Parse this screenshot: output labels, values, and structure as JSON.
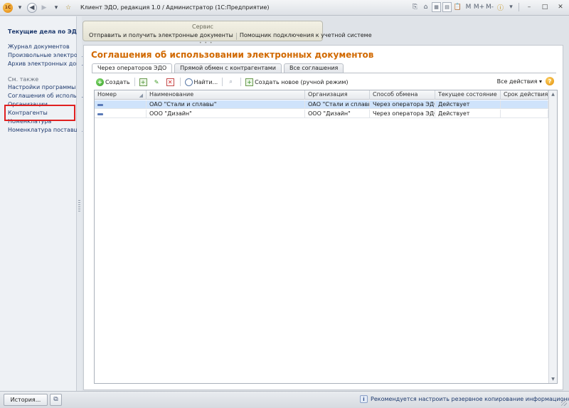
{
  "window": {
    "title": "Клиент ЭДО, редакция 1.0 / Администратор  (1С:Предприятие)",
    "right_icons": [
      "M",
      "M+",
      "M-"
    ]
  },
  "left_panel": {
    "title": "Текущие дела по ЭДО",
    "links": [
      "Журнал документов",
      "Произвольные электро...",
      "Архив электронных док..."
    ],
    "see_also_label": "См. также",
    "see_also_links": [
      "Настройки программы",
      "Соглашения об использ...",
      "Организации",
      "Контрагенты",
      "Номенклатура",
      "Номенклатура поставщ..."
    ]
  },
  "service": {
    "title": "Сервис",
    "commands": [
      "Отправить и получить электронные документы",
      "Помощник подключения к учетной системе"
    ]
  },
  "form": {
    "title": "Соглашения об использовании электронных документов",
    "tabs": [
      "Через операторов ЭДО",
      "Прямой обмен с контрагентами",
      "Все соглашения"
    ],
    "toolbar": {
      "create": "Создать",
      "find": "Найти...",
      "create_new": "Создать новое (ручной режим)",
      "all_actions": "Все действия",
      "help": "?"
    },
    "columns": [
      "Номер",
      "Наименование",
      "Организация",
      "Способ обмена",
      "Текущее состояние",
      "Срок действия"
    ],
    "rows": [
      {
        "number": "",
        "name": "ОАО \"Стали и сплавы\"",
        "org": "ОАО \"Стали и сплавы\"",
        "method": "Через оператора ЭДО ...",
        "state": "Действует",
        "term": ""
      },
      {
        "number": "",
        "name": "ООО \"Дизайн\"",
        "org": "ООО \"Дизайн\"",
        "method": "Через оператора ЭДО ...",
        "state": "Действует",
        "term": ""
      }
    ]
  },
  "statusbar": {
    "history": "История...",
    "message": "Рекомендуется настроить резервное копирование информационной базы."
  },
  "colors": {
    "form_title": "#d16900",
    "link": "#1e3a6e",
    "selected_row": "#cfe3fb",
    "highlight_box": "#e02020"
  }
}
